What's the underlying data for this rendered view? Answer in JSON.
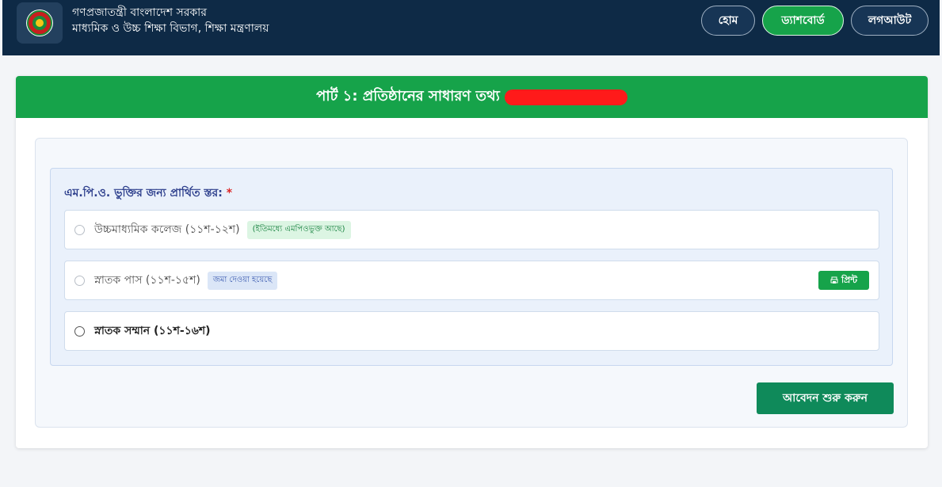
{
  "header": {
    "title_line1": "গণপ্রজাতন্ত্রী বাংলাদেশ সরকার",
    "title_line2": "মাধ্যমিক ও উচ্চ শিক্ষা বিভাগ, শিক্ষা মন্ত্রণালয়",
    "nav": {
      "home": "হোম",
      "dashboard": "ড্যাশবোর্ড",
      "logout": "লগআউট"
    }
  },
  "card": {
    "heading": "পার্ট ১: প্রতিষ্ঠানের সাধারণ তথ্য"
  },
  "form": {
    "label": "এম.পি.ও. ভুক্তির জন্য প্রার্থিত স্তর:",
    "required_mark": "*",
    "options": [
      {
        "label": "উচ্চমাধ্যমিক কলেজ (১১শ-১২শ)",
        "badge": "(ইতিমধ্যে এমপিওভুক্ত আছে)"
      },
      {
        "label": "স্নাতক পাস (১১শ-১৫শ)",
        "badge": "জমা দেওয়া হয়েছে",
        "action": "প্রিন্ট"
      },
      {
        "label": "স্নাতক সম্মান (১১শ-১৬শ)"
      }
    ],
    "submit": "আবেদন শুরু করুন"
  },
  "colors": {
    "navy": "#0e2a46",
    "green": "#16a34a",
    "submit_green": "#0f8a5a"
  }
}
